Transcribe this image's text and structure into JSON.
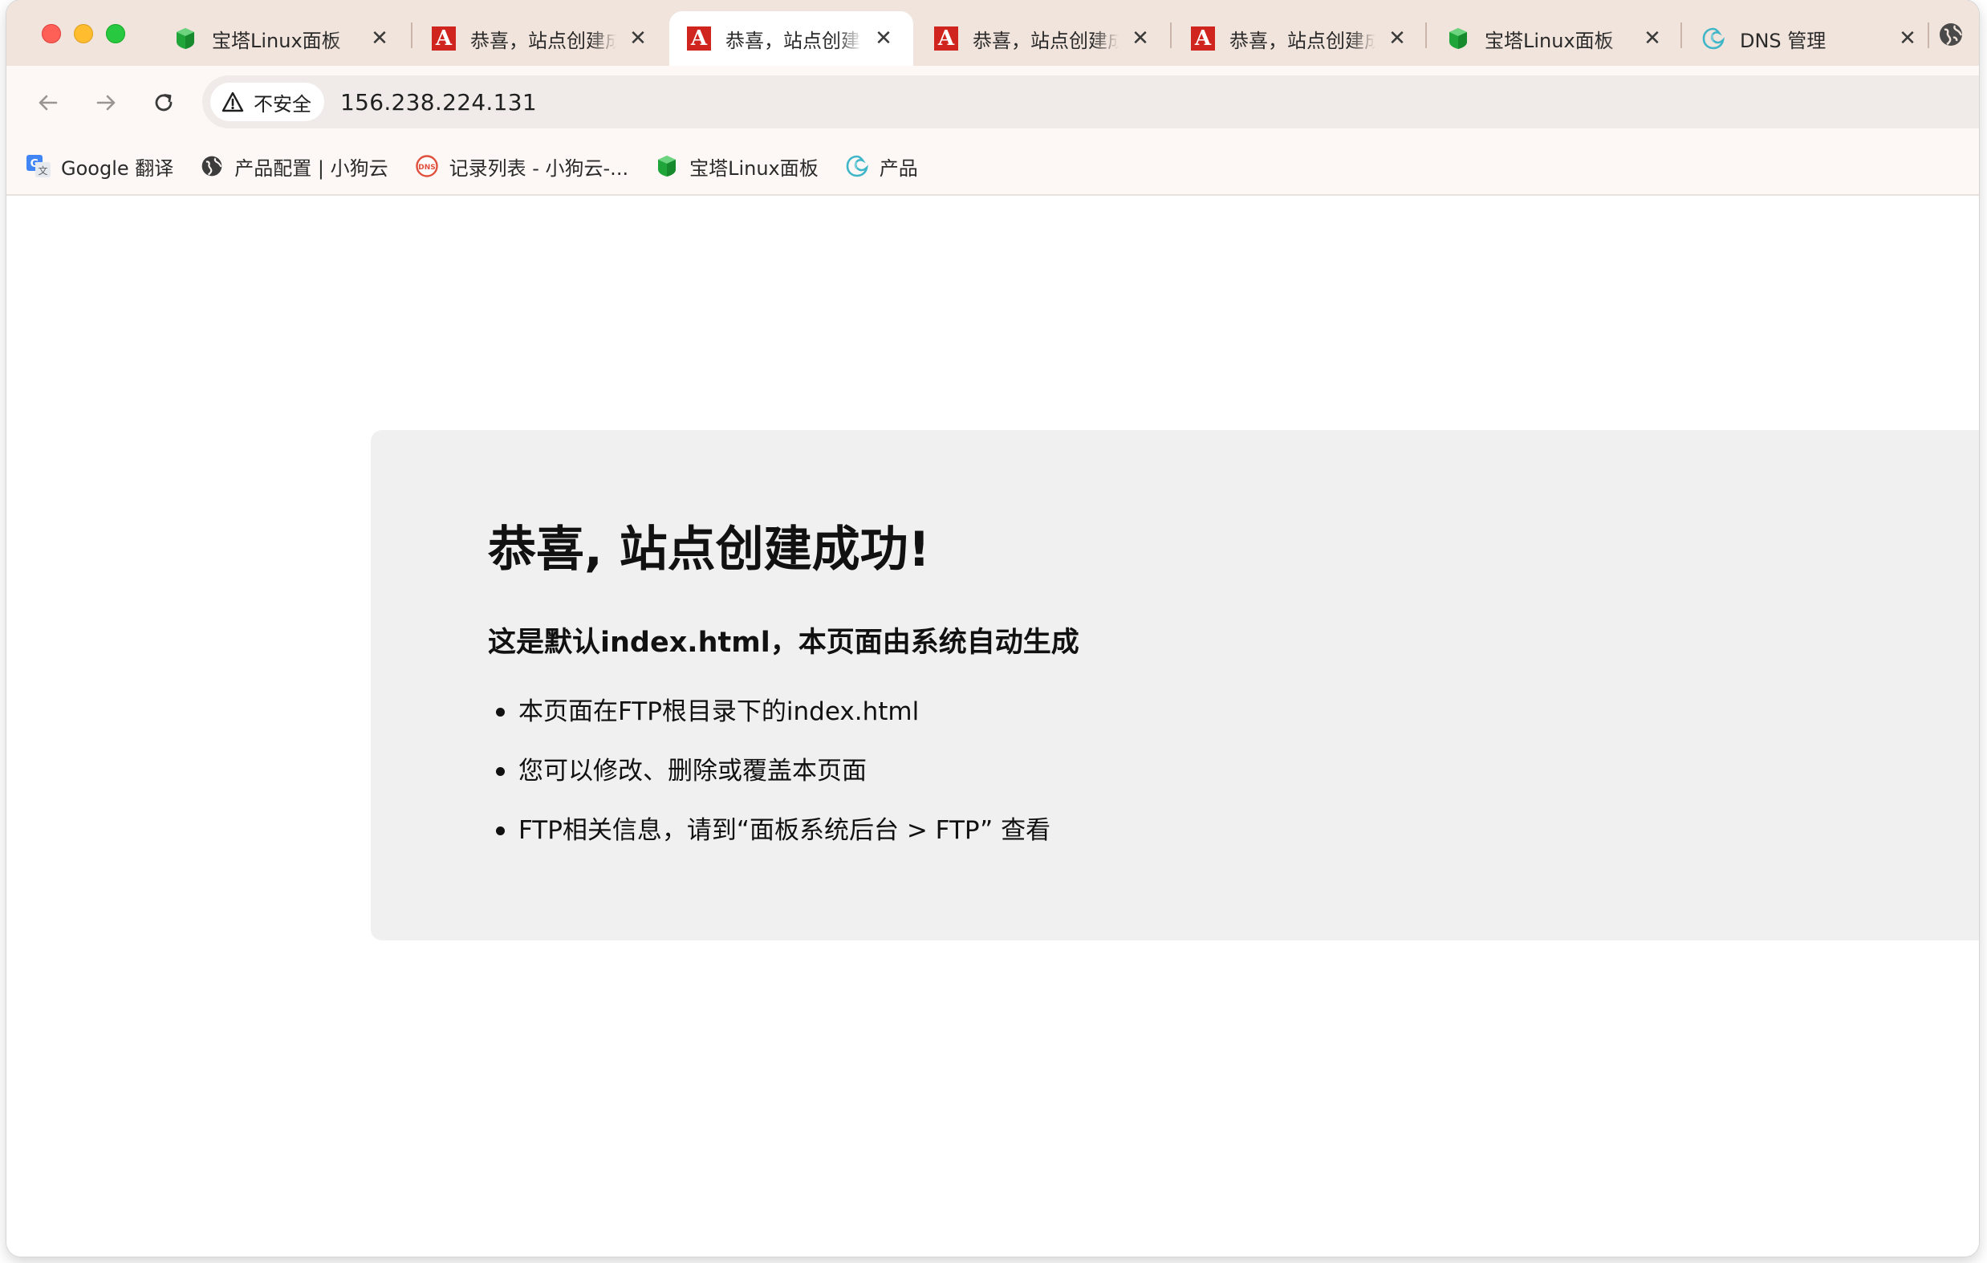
{
  "browser": {
    "tabs": [
      {
        "title": "宝塔Linux面板",
        "icon": "baota-shield-icon",
        "active": false
      },
      {
        "title": "恭喜，站点创建成功！",
        "icon": "a-letter-icon",
        "active": false
      },
      {
        "title": "恭喜，站点创建成功！",
        "icon": "a-letter-icon",
        "active": true
      },
      {
        "title": "恭喜，站点创建成功！",
        "icon": "a-letter-icon",
        "active": false
      },
      {
        "title": "恭喜，站点创建成功！",
        "icon": "a-letter-icon",
        "active": false
      },
      {
        "title": "宝塔Linux面板",
        "icon": "baota-shield-icon",
        "active": false
      },
      {
        "title": "DNS 管理",
        "icon": "cloud-swirl-icon",
        "active": false
      }
    ],
    "close_glyph": "✕",
    "security_label": "不安全",
    "url": "156.238.224.131"
  },
  "bookmarks": [
    {
      "label": "Google 翻译",
      "icon": "google-translate-icon"
    },
    {
      "label": "产品配置 | 小狗云",
      "icon": "globe-icon"
    },
    {
      "label": "记录列表 - 小狗云-...",
      "icon": "dns-badge-icon"
    },
    {
      "label": "宝塔Linux面板",
      "icon": "baota-shield-icon"
    },
    {
      "label": "产品",
      "icon": "cloud-swirl-icon"
    }
  ],
  "page": {
    "heading": "恭喜, 站点创建成功!",
    "subheading": "这是默认index.html，本页面由系统自动生成",
    "items": [
      "本页面在FTP根目录下的index.html",
      "您可以修改、删除或覆盖本页面",
      "FTP相关信息，请到“面板系统后台 > FTP” 查看"
    ]
  },
  "colors": {
    "tabstrip": "#f1e4dc",
    "toolbar": "#fdf8f5",
    "card": "#f0f0f0",
    "favicon_red": "#d0241f",
    "baota_green": "#20a53a"
  }
}
